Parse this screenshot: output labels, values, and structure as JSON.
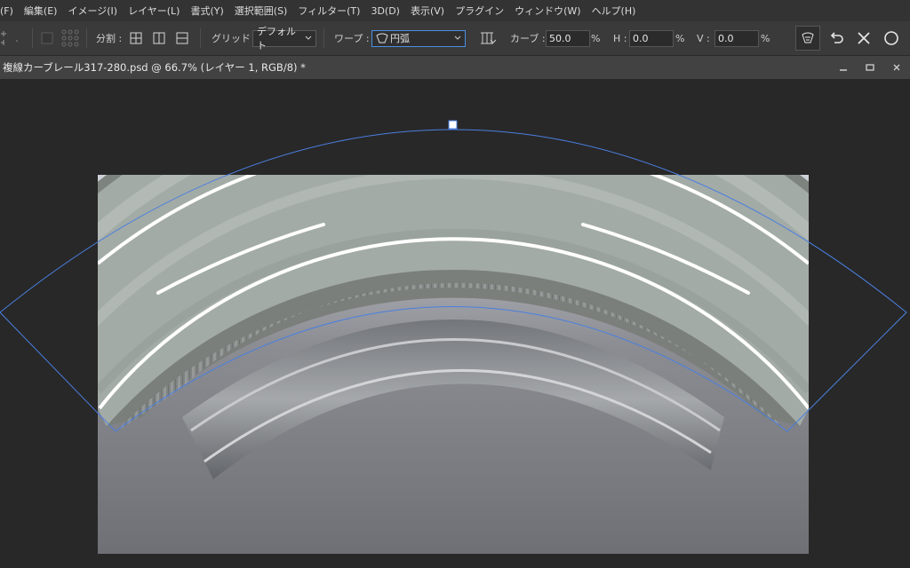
{
  "menu": [
    "(F)",
    "編集(E)",
    "イメージ(I)",
    "レイヤー(L)",
    "書式(Y)",
    "選択範囲(S)",
    "フィルター(T)",
    "3D(D)",
    "表示(V)",
    "プラグイン",
    "ウィンドウ(W)",
    "ヘルプ(H)"
  ],
  "options": {
    "split_label": "分割 :",
    "grid_label": "グリッド :",
    "grid_value": "デフォルト",
    "warp_label": "ワープ :",
    "warp_value": "円弧",
    "curve_label": "カーブ :",
    "curve_value": "50.0",
    "curve_unit": "%",
    "h_label": "H :",
    "h_value": "0.0",
    "h_unit": "%",
    "v_label": "V :",
    "v_value": "0.0",
    "v_unit": "%"
  },
  "document": {
    "title": "複線カーブレール317-280.psd @ 66.7% (レイヤー 1, RGB/8) *"
  },
  "colors": {
    "warp_outline": "#4a7fe0",
    "road": "#a2aba6",
    "road_edge": "#7a7f7a",
    "lane_marking": "#ffffff",
    "background": "#282828"
  }
}
